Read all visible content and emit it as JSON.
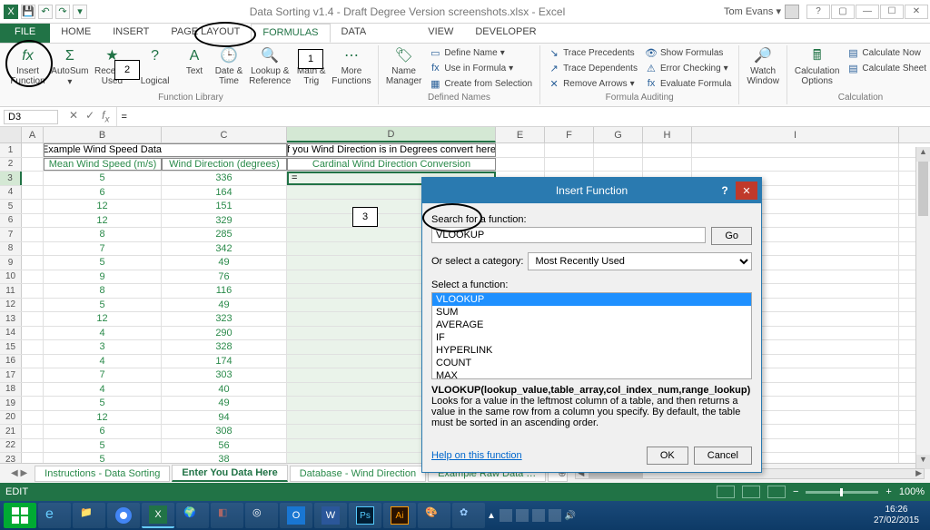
{
  "window": {
    "title": "Data Sorting v1.4 - Draft Degree Version screenshots.xlsx - Excel",
    "user": "Tom Evans"
  },
  "ribbon_tabs": [
    "FILE",
    "HOME",
    "INSERT",
    "PAGE LAYOUT",
    "FORMULAS",
    "DATA",
    "",
    "VIEW",
    "DEVELOPER"
  ],
  "ribbon": {
    "insert_function": "Insert\nFunction",
    "autosum": "AutoSum",
    "recently": "Recently\nUsed",
    "logical": "Logical",
    "text": "Text",
    "datetime": "Date &\nTime",
    "lookup": "Lookup &\nReference",
    "mathtrig": "Math &\nTrig",
    "more": "More\nFunctions",
    "group_fl": "Function Library",
    "name_mgr": "Name\nManager",
    "define_name": "Define Name",
    "use_formula": "Use in Formula",
    "create_sel": "Create from Selection",
    "group_dn": "Defined Names",
    "trace_prec": "Trace Precedents",
    "trace_dep": "Trace Dependents",
    "remove_arr": "Remove Arrows",
    "show_form": "Show Formulas",
    "error_chk": "Error Checking",
    "eval_form": "Evaluate Formula",
    "group_fa": "Formula Auditing",
    "watch": "Watch\nWindow",
    "calc_opts": "Calculation\nOptions",
    "calc_now": "Calculate Now",
    "calc_sheet": "Calculate Sheet",
    "group_calc": "Calculation"
  },
  "callouts": {
    "one": "1",
    "two": "2",
    "three": "3"
  },
  "fx": {
    "namebox": "D3",
    "formula": "="
  },
  "cols": [
    "A",
    "B",
    "C",
    "D",
    "E",
    "F",
    "G",
    "H",
    "I"
  ],
  "headers": {
    "title1": "Example Wind Speed Data:",
    "title2": "If you Wind Direction is in Degrees convert here:",
    "h_b": "Mean Wind Speed (m/s)",
    "h_c": "Wind Direction (degrees)",
    "h_d": "Cardinal Wind Direction Conversion"
  },
  "data_rows": [
    [
      5,
      336,
      "="
    ],
    [
      6,
      164,
      ""
    ],
    [
      12,
      151,
      ""
    ],
    [
      12,
      329,
      ""
    ],
    [
      8,
      285,
      ""
    ],
    [
      7,
      342,
      ""
    ],
    [
      5,
      49,
      ""
    ],
    [
      9,
      76,
      ""
    ],
    [
      8,
      116,
      ""
    ],
    [
      5,
      49,
      ""
    ],
    [
      12,
      323,
      ""
    ],
    [
      4,
      290,
      ""
    ],
    [
      3,
      328,
      ""
    ],
    [
      4,
      174,
      ""
    ],
    [
      7,
      303,
      ""
    ],
    [
      4,
      40,
      ""
    ],
    [
      5,
      49,
      ""
    ],
    [
      12,
      94,
      ""
    ],
    [
      6,
      308,
      ""
    ],
    [
      5,
      56,
      ""
    ],
    [
      5,
      38,
      ""
    ]
  ],
  "sheet_tabs": [
    "Instructions - Data Sorting",
    "Enter You Data Here",
    "Database - Wind Direction",
    "Example Raw Data …"
  ],
  "status": {
    "mode": "EDIT",
    "zoom": "100%"
  },
  "dialog": {
    "title": "Insert Function",
    "search_lbl": "Search for a function:",
    "search_val": "VLOOKUP",
    "go": "Go",
    "cat_lbl": "Or select a category:",
    "cat_val": "Most Recently Used",
    "select_lbl": "Select a function:",
    "funcs": [
      "VLOOKUP",
      "SUM",
      "AVERAGE",
      "IF",
      "HYPERLINK",
      "COUNT",
      "MAX"
    ],
    "sig": "VLOOKUP(lookup_value,table_array,col_index_num,range_lookup)",
    "desc": "Looks for a value in the leftmost column of a table, and then returns a value in the same row from a column you specify. By default, the table must be sorted in an ascending order.",
    "help": "Help on this function",
    "ok": "OK",
    "cancel": "Cancel"
  },
  "clock": {
    "time": "16:26",
    "date": "27/02/2015"
  }
}
